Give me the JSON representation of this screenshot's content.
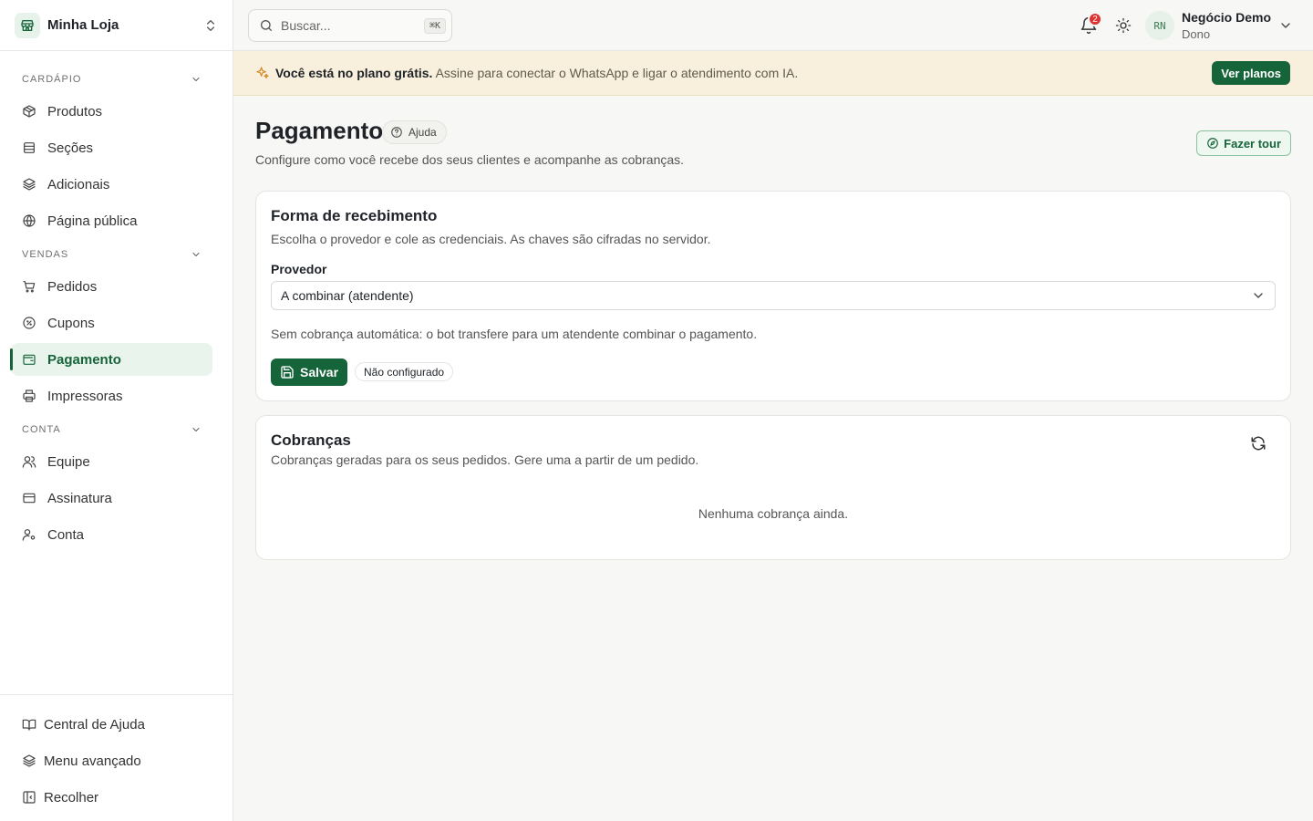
{
  "store": {
    "name": "Minha Loja"
  },
  "sidebar": {
    "groups": [
      {
        "title": "CARDÁPIO",
        "items": [
          {
            "label": "Produtos",
            "icon": "box-icon"
          },
          {
            "label": "Seções",
            "icon": "sections-icon"
          },
          {
            "label": "Adicionais",
            "icon": "layers-icon"
          },
          {
            "label": "Página pública",
            "icon": "globe-icon"
          }
        ]
      },
      {
        "title": "VENDAS",
        "items": [
          {
            "label": "Pedidos",
            "icon": "cart-icon"
          },
          {
            "label": "Cupons",
            "icon": "coupon-icon"
          },
          {
            "label": "Pagamento",
            "icon": "wallet-icon",
            "active": true
          },
          {
            "label": "Impressoras",
            "icon": "printer-icon"
          }
        ]
      },
      {
        "title": "CONTA",
        "items": [
          {
            "label": "Equipe",
            "icon": "users-icon"
          },
          {
            "label": "Assinatura",
            "icon": "credit-card-icon"
          },
          {
            "label": "Conta",
            "icon": "user-cog-icon"
          }
        ]
      }
    ],
    "footer": [
      {
        "label": "Central de Ajuda",
        "icon": "book-icon"
      },
      {
        "label": "Menu avançado",
        "icon": "layers-icon"
      },
      {
        "label": "Recolher",
        "icon": "sidebar-collapse-icon"
      }
    ]
  },
  "topbar": {
    "search_placeholder": "Buscar...",
    "shortcut": "⌘K",
    "notifications_count": "2",
    "user": {
      "initials": "RN",
      "name": "Negócio Demo",
      "role": "Dono"
    }
  },
  "banner": {
    "bold": "Você está no plano grátis.",
    "text": "Assine para conectar o WhatsApp e ligar o atendimento com IA.",
    "button": "Ver planos"
  },
  "page": {
    "title": "Pagamento",
    "help": "Ajuda",
    "subtitle": "Configure como você recebe dos seus clientes e acompanhe as cobranças.",
    "tour": "Fazer tour"
  },
  "payment_card": {
    "title": "Forma de recebimento",
    "description": "Escolha o provedor e cole as credenciais. As chaves são cifradas no servidor.",
    "provider_label": "Provedor",
    "provider_value": "A combinar (atendente)",
    "info": "Sem cobrança automática: o bot transfere para um atendente combinar o pagamento.",
    "save": "Salvar",
    "status": "Não configurado"
  },
  "charges_card": {
    "title": "Cobranças",
    "description": "Cobranças geradas para os seus pedidos. Gere uma a partir de um pedido.",
    "empty": "Nenhuma cobrança ainda."
  },
  "colors": {
    "brand": "#16643a",
    "banner_bg": "#f8f0dc",
    "badge": "#e03131"
  }
}
